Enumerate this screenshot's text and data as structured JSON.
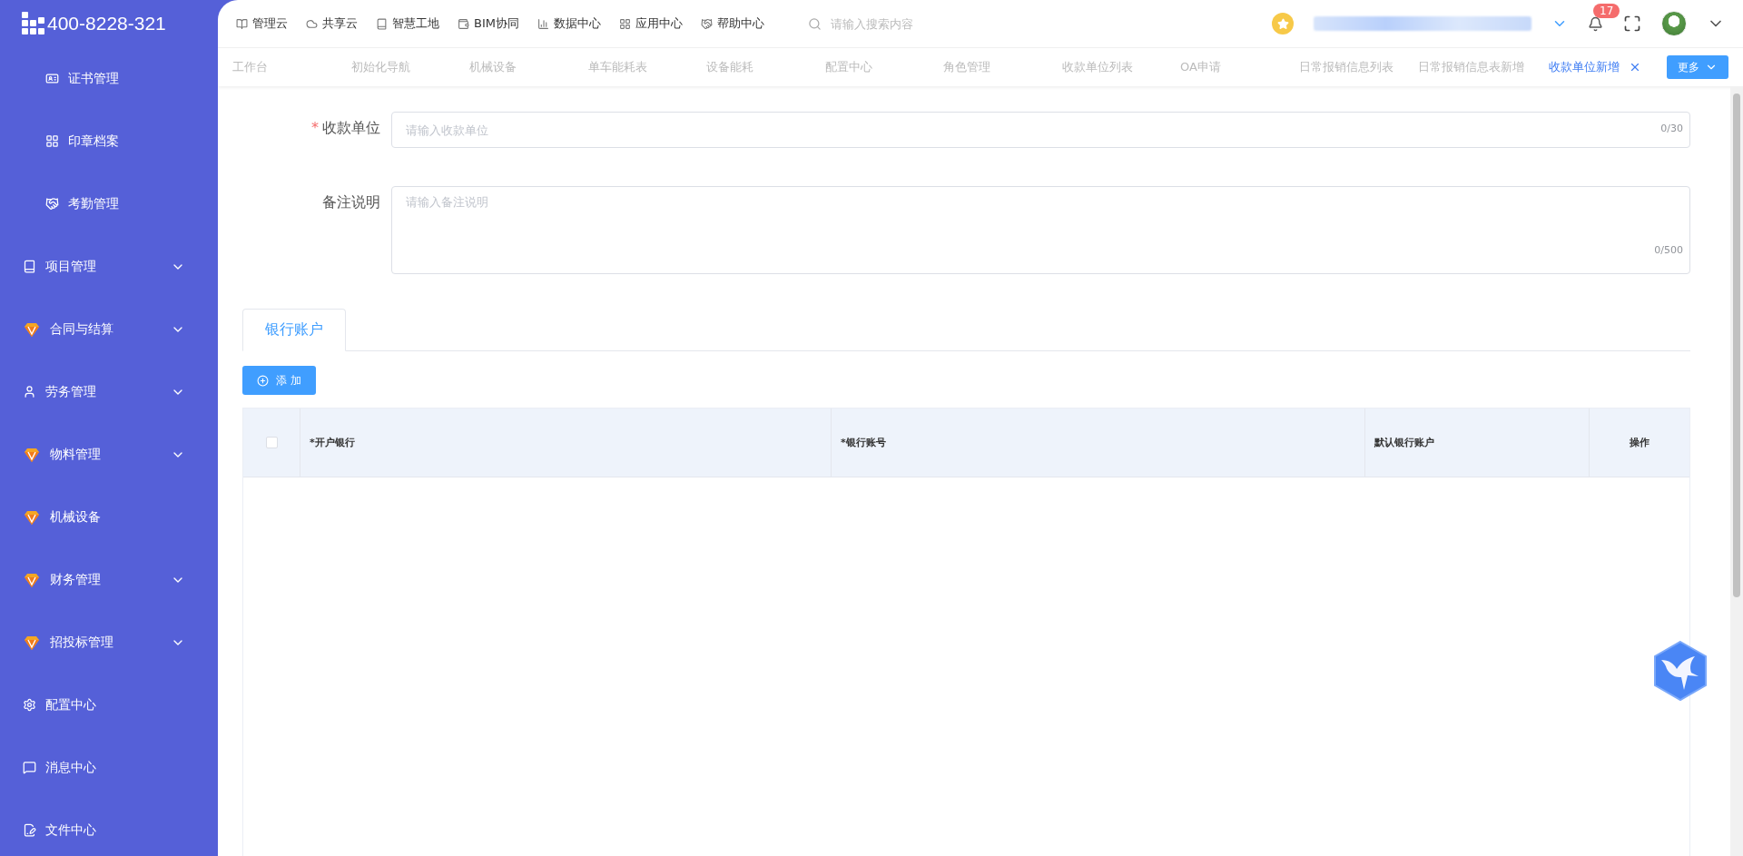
{
  "logo": {
    "text": "400-8228-321"
  },
  "sidebar": {
    "items": [
      {
        "label": "证书管理",
        "kind": "sub"
      },
      {
        "label": "印章档案",
        "kind": "sub"
      },
      {
        "label": "考勤管理",
        "kind": "sub"
      },
      {
        "label": "项目管理",
        "kind": "group"
      },
      {
        "label": "合同与结算",
        "kind": "group"
      },
      {
        "label": "劳务管理",
        "kind": "group"
      },
      {
        "label": "物料管理",
        "kind": "group"
      },
      {
        "label": "机械设备",
        "kind": "link"
      },
      {
        "label": "财务管理",
        "kind": "group"
      },
      {
        "label": "招投标管理",
        "kind": "group"
      },
      {
        "label": "配置中心",
        "kind": "link"
      },
      {
        "label": "消息中心",
        "kind": "link"
      },
      {
        "label": "文件中心",
        "kind": "link"
      }
    ]
  },
  "top_nav": [
    {
      "label": "管理云"
    },
    {
      "label": "共享云"
    },
    {
      "label": "智慧工地"
    },
    {
      "label": "BIM协同"
    },
    {
      "label": "数据中心"
    },
    {
      "label": "应用中心"
    },
    {
      "label": "帮助中心"
    }
  ],
  "search": {
    "placeholder": "请输入搜索内容"
  },
  "notifications": {
    "count": "17"
  },
  "tabs": [
    {
      "label": "工作台",
      "selected": false
    },
    {
      "label": "初始化导航",
      "selected": false
    },
    {
      "label": "机械设备",
      "selected": false
    },
    {
      "label": "单车能耗表",
      "selected": false
    },
    {
      "label": "设备能耗",
      "selected": false
    },
    {
      "label": "配置中心",
      "selected": false
    },
    {
      "label": "角色管理",
      "selected": false
    },
    {
      "label": "收款单位列表",
      "selected": false
    },
    {
      "label": "OA申请",
      "selected": false
    },
    {
      "label": "日常报销信息列表",
      "selected": false
    },
    {
      "label": "日常报销信息表新增",
      "selected": false
    },
    {
      "label": "收款单位新增",
      "selected": true
    }
  ],
  "more_button": "更多",
  "form": [
    {
      "label": "收款单位",
      "required_mark": "*",
      "kind": "input",
      "placeholder": "请输入收款单位",
      "counter": "0/30"
    },
    {
      "label": "备注说明",
      "kind": "textarea",
      "placeholder": "请输入备注说明",
      "counter": "0/500"
    }
  ],
  "section_tabs": [
    {
      "label": "银行账户",
      "selected": true
    }
  ],
  "add_button": "添 加",
  "table": {
    "select_all_checked": false,
    "columns": [
      "*开户银行",
      "*银行账号",
      "默认银行账户",
      "操作"
    ]
  }
}
